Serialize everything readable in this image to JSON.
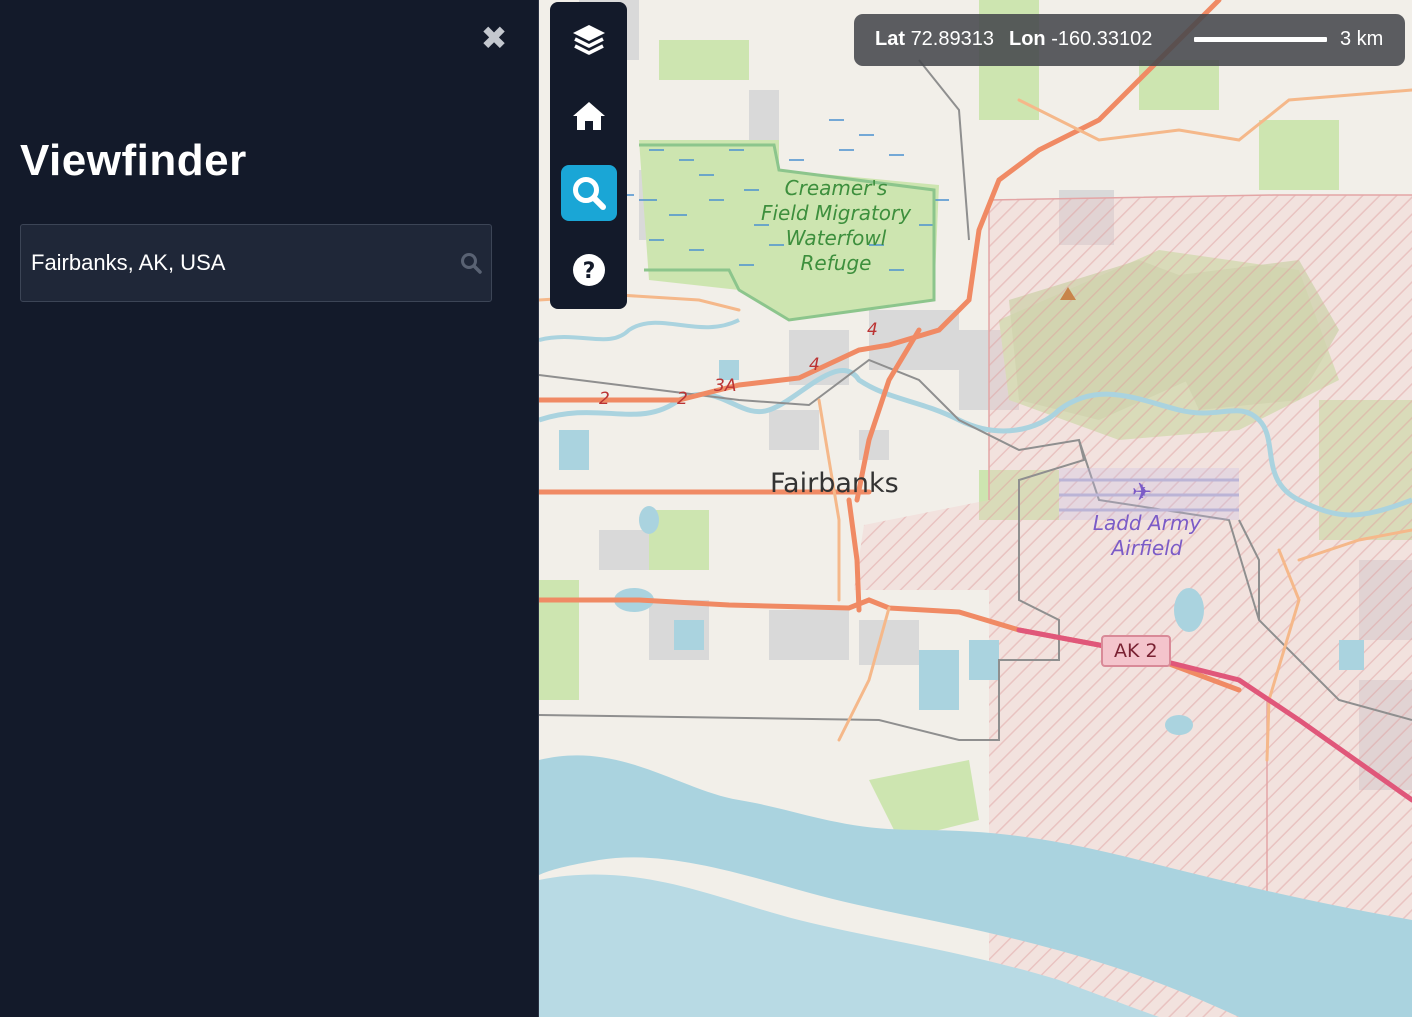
{
  "app": {
    "title": "Viewfinder"
  },
  "search": {
    "value": "Fairbanks, AK, USA"
  },
  "toolbar": {
    "items": [
      {
        "name": "layers",
        "icon": "layers-icon"
      },
      {
        "name": "home",
        "icon": "home-icon"
      },
      {
        "name": "search",
        "icon": "search-icon",
        "active": true
      },
      {
        "name": "help",
        "icon": "help-icon"
      }
    ],
    "accent_color": "#1aa6d6"
  },
  "coords": {
    "lat_label": "Lat",
    "lat_value": "72.89313",
    "lon_label": "Lon",
    "lon_value": "-160.33102",
    "scale_text": "3 km"
  },
  "map": {
    "city_label": "Fairbanks",
    "refuge_lines": [
      "Creamer's",
      "Field Migratory",
      "Waterfowl",
      "Refuge"
    ],
    "airfield_lines": [
      "Ladd Army",
      "Airfield"
    ],
    "road_shield": "AK 2",
    "route_labels": [
      "2",
      "2",
      "3A",
      "4",
      "4"
    ]
  }
}
